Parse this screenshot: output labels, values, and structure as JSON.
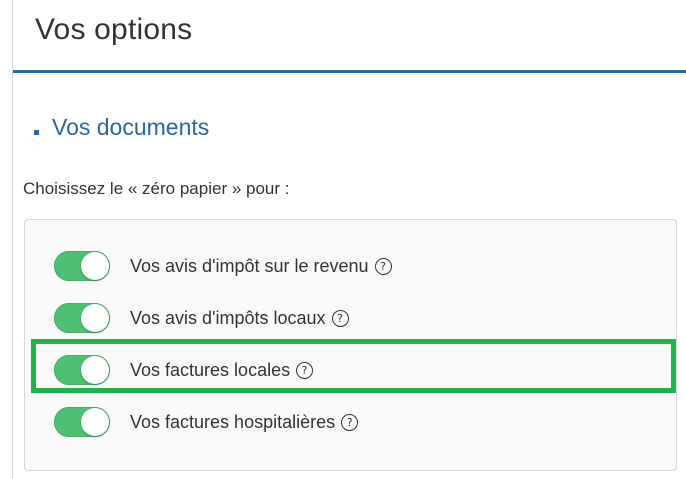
{
  "header": {
    "title": "Vos options"
  },
  "section": {
    "title": "Vos documents"
  },
  "intro": "Choisissez le « zéro papier » pour :",
  "options": [
    {
      "label": "Vos avis d'impôt sur le revenu",
      "enabled": true
    },
    {
      "label": "Vos avis d'impôts locaux",
      "enabled": true
    },
    {
      "label": "Vos factures locales",
      "enabled": true,
      "highlighted": true
    },
    {
      "label": "Vos factures hospitalières",
      "enabled": true
    }
  ],
  "icons": {
    "help": "?"
  },
  "colors": {
    "accent": "#2a66a0",
    "toggle_on": "#4fbf73",
    "highlight": "#22b14c"
  }
}
